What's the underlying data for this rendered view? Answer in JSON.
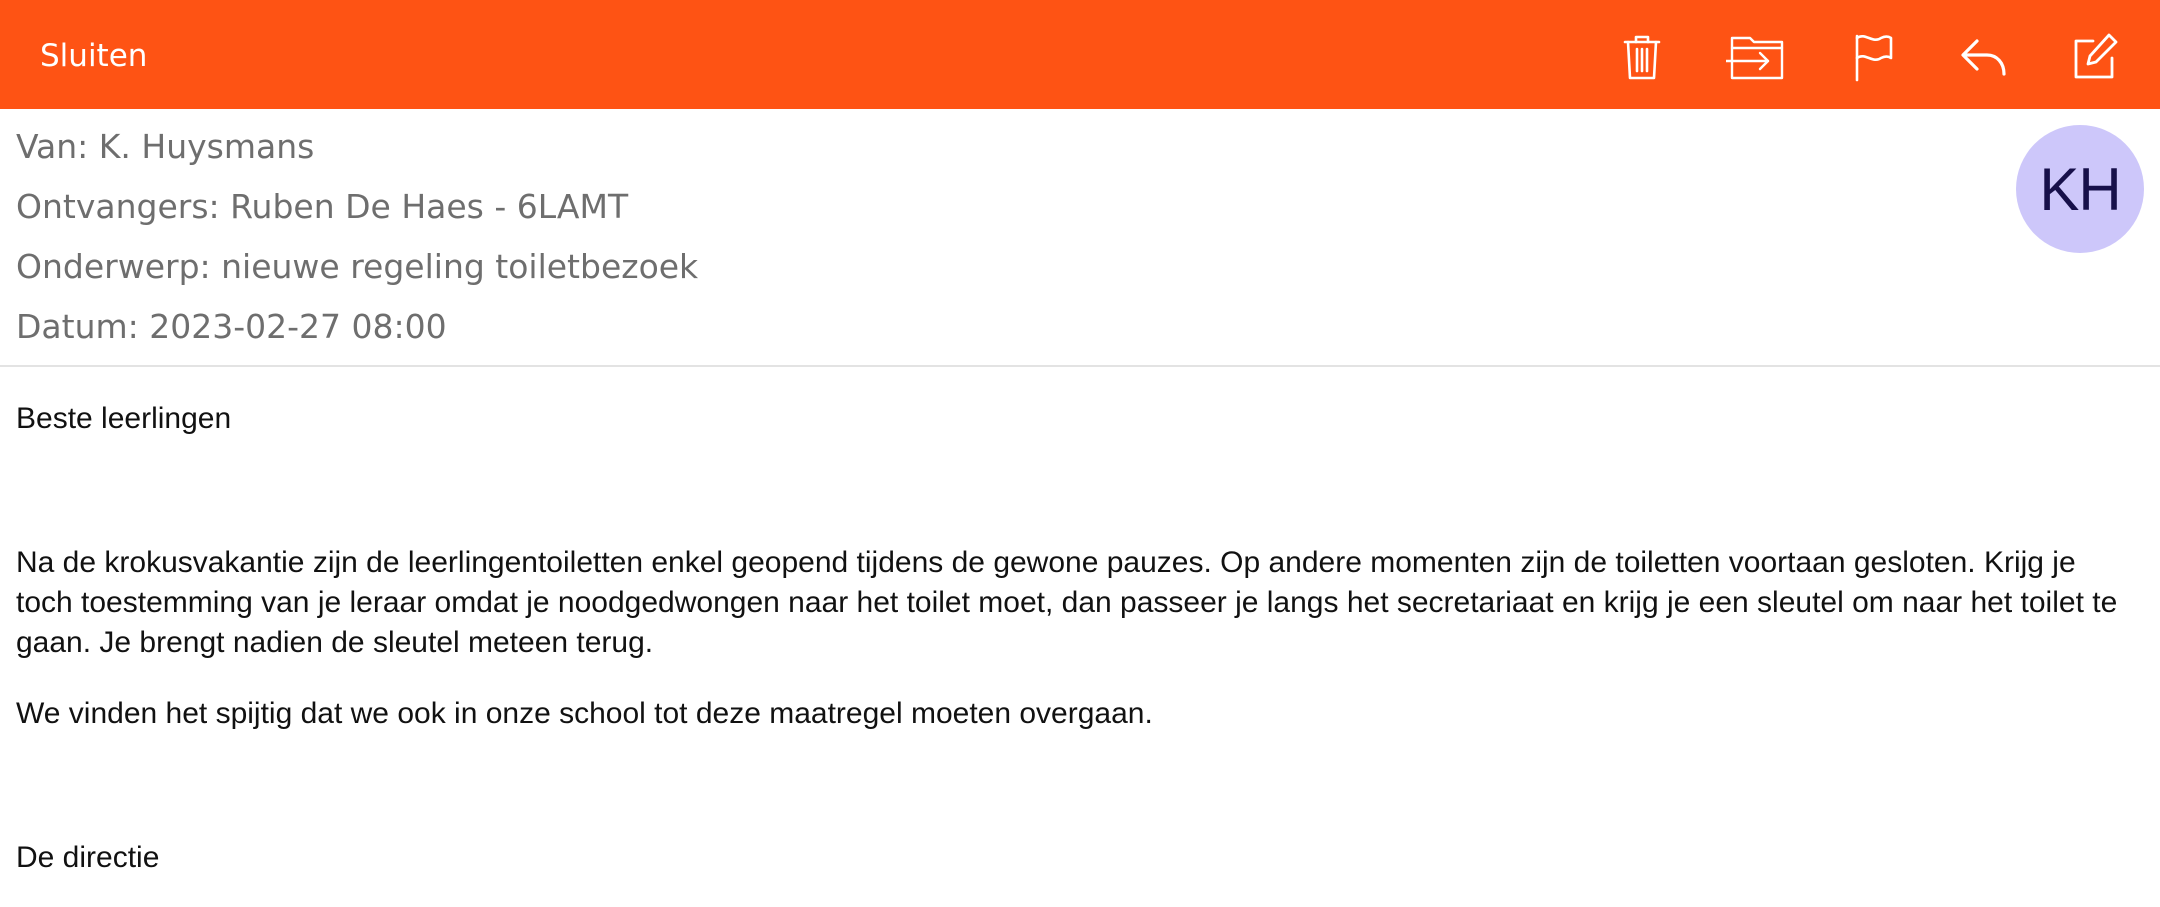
{
  "toolbar": {
    "close_label": "Sluiten",
    "background": "#fe5314",
    "icons": [
      "trash-icon",
      "move-to-folder-icon",
      "flag-icon",
      "reply-icon",
      "compose-icon"
    ]
  },
  "header": {
    "from": "Van: K. Huysmans",
    "recipients": "Ontvangers: Ruben De Haes - 6LAMT",
    "subject": "Onderwerp: nieuwe regeling toiletbezoek",
    "date": "Datum: 2023-02-27 08:00",
    "avatar_initials": "KH",
    "avatar_color": "#cdc7fa"
  },
  "message": {
    "greeting": "Beste leerlingen",
    "paragraph1": "Na de krokusvakantie zijn de leerlingentoiletten enkel geopend tijdens de gewone pauzes.  Op andere momenten zijn de toiletten voortaan gesloten. Krijg je toch toestemming van je leraar omdat je noodgedwongen naar het toilet moet, dan passeer je langs het secretariaat en krijg je een sleutel om naar het toilet te gaan.  Je brengt nadien de sleutel meteen terug.",
    "paragraph2": "We vinden het spijtig dat we ook in onze school tot deze maatregel moeten overgaan.",
    "signature": "De directie"
  }
}
